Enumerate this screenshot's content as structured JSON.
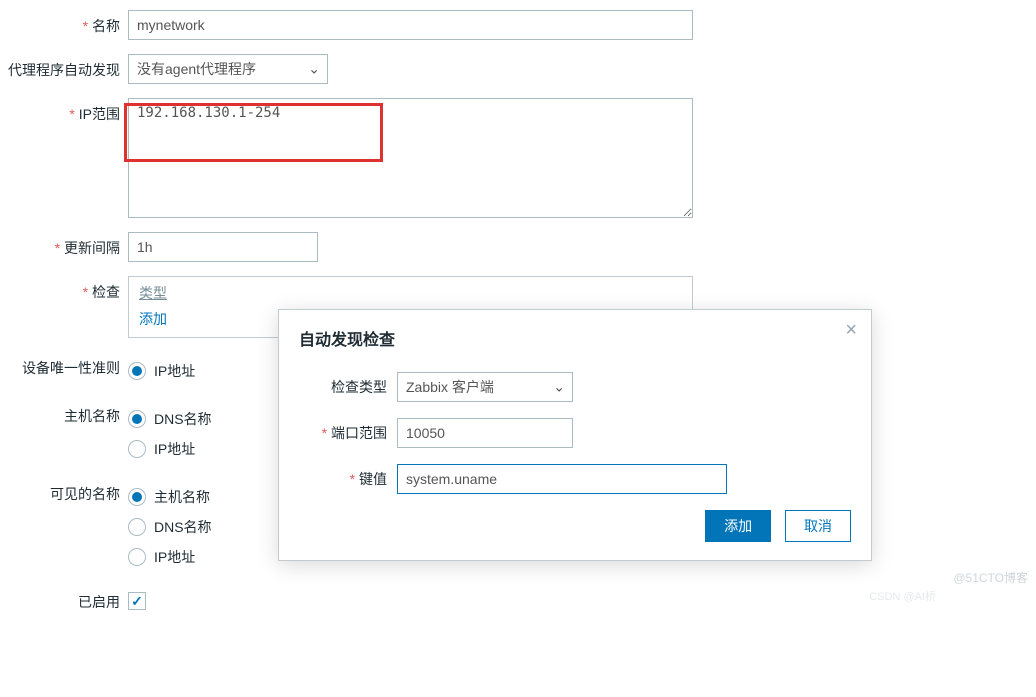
{
  "form": {
    "name_label": "名称",
    "name_value": "mynetwork",
    "proxy_label": "代理程序自动发现",
    "proxy_value": "没有agent代理程序",
    "ip_range_label": "IP范围",
    "ip_range_value": "192.168.130.1-254",
    "interval_label": "更新间隔",
    "interval_value": "1h",
    "checks_label": "检查",
    "checks_type_header": "类型",
    "checks_add": "添加",
    "uniqueness_label": "设备唯一性准则",
    "uniqueness_options": [
      "IP地址"
    ],
    "hostname_label": "主机名称",
    "hostname_options": [
      "DNS名称",
      "IP地址"
    ],
    "visiblename_label": "可见的名称",
    "visiblename_options": [
      "主机名称",
      "DNS名称",
      "IP地址"
    ],
    "enabled_label": "已启用"
  },
  "modal": {
    "title": "自动发现检查",
    "type_label": "检查类型",
    "type_value": "Zabbix 客户端",
    "port_label": "端口范围",
    "port_value": "10050",
    "key_label": "键值",
    "key_value": "system.uname",
    "add_btn": "添加",
    "cancel_btn": "取消"
  },
  "watermark1": "@51CTO博客",
  "watermark2": "CSDN @AI桥"
}
